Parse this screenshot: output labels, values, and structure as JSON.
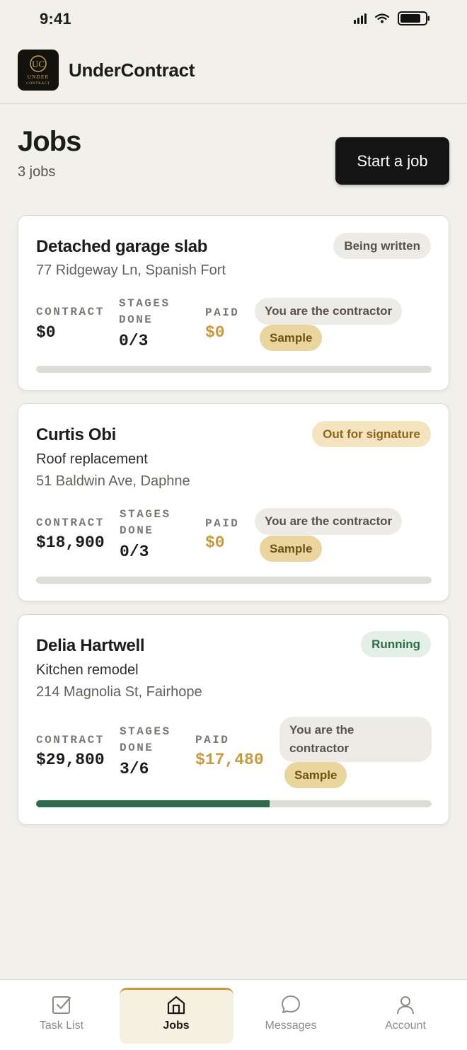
{
  "status_bar": {
    "time": "9:41"
  },
  "header": {
    "app_name": "UnderContract",
    "logo_text_1": "UC",
    "logo_text_2": "UNDER",
    "logo_text_3": "CONTRACT"
  },
  "page": {
    "title": "Jobs",
    "count": "3 jobs",
    "start_button": "Start a job"
  },
  "stat_labels": {
    "contract": "CONTRACT",
    "stages_1": "STAGES",
    "stages_2": "DONE",
    "paid": "PAID"
  },
  "jobs": [
    {
      "title": "Detached garage slab",
      "subtitle": "",
      "address": "77 Ridgeway Ln, Spanish Fort",
      "status": "Being written",
      "status_color": "#55534e",
      "contract": "$0",
      "stages": "0/3",
      "paid": "$0",
      "role": "You are the contractor",
      "sample": "Sample",
      "progress": 0
    },
    {
      "title": "Curtis Obi",
      "subtitle": "Roof replacement",
      "address": "51 Baldwin Ave, Daphne",
      "status": "Out for signature",
      "status_color": "#8d6619",
      "contract": "$18,900",
      "stages": "0/3",
      "paid": "$0",
      "role": "You are the contractor",
      "sample": "Sample",
      "progress": 0
    },
    {
      "title": "Delia Hartwell",
      "subtitle": "Kitchen remodel",
      "address": "214 Magnolia St, Fairhope",
      "status": "Running",
      "status_color": "#2c6e4a",
      "contract": "$29,800",
      "stages": "3/6",
      "paid": "$17,480",
      "role_line1": "You are the",
      "role_line2": "contractor",
      "sample": "Sample",
      "progress": 0.59
    }
  ],
  "nav": [
    {
      "label": "Task List",
      "icon": "checkbox-icon"
    },
    {
      "label": "Jobs",
      "icon": "home-icon",
      "active": true
    },
    {
      "label": "Messages",
      "icon": "chat-bubble-icon"
    },
    {
      "label": "Account",
      "icon": "user-icon"
    }
  ],
  "colors": {
    "accent_gold": "#c89a3e",
    "progress_green": "#2e6b4b",
    "background": "#f1f0eb"
  }
}
